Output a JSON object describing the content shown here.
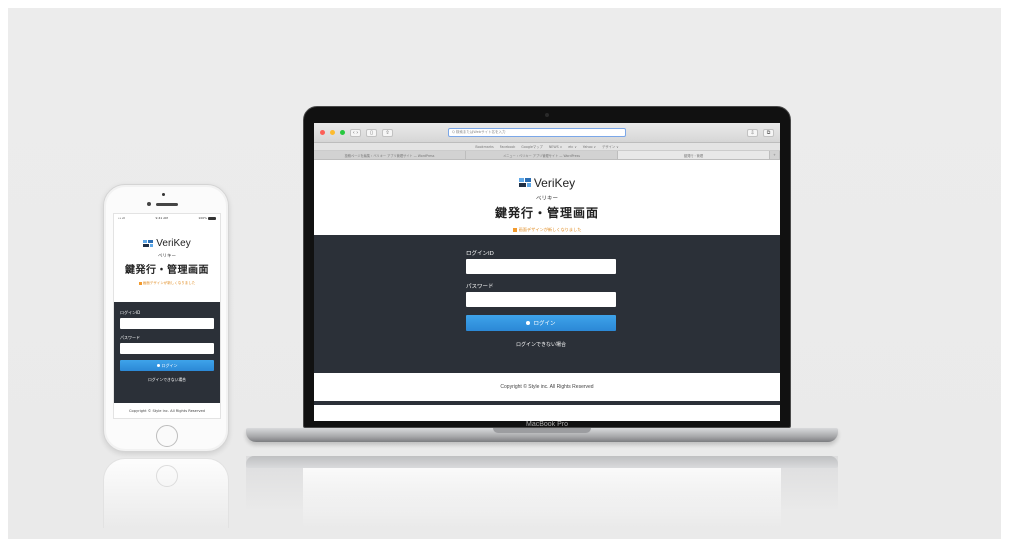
{
  "brand": {
    "name": "VeriKey",
    "kana": "ベリキー",
    "title": "鍵発行・管理画面",
    "notice": "画面デザインが新しくなりました",
    "colors": {
      "primary": "#2a6db3",
      "accent": "#5fa8e8",
      "dark_panel": "#2b3038",
      "notice": "#e08a1e",
      "button": "#2b88d6"
    }
  },
  "form": {
    "login_id_label": "ログインID",
    "password_label": "パスワード",
    "login_button": "ログイン",
    "help_link": "ログインできない場合"
  },
  "footer": {
    "copyright": "Copyright © Style inc. All Rights Reserved",
    "copyright_phone": "Copyright © Style inc. All Rights Reserved"
  },
  "phone": {
    "status_time": "9:41 AM",
    "status_carrier": "•••ll",
    "status_battery": "100%"
  },
  "browser": {
    "url_placeholder": "Q 検索またはWebサイト名を入力",
    "bookmarks": [
      "Bookmarks",
      "Facebook",
      "Googleマップ",
      "NEWS ∨",
      "etc ∨",
      "Yahoo ∨",
      "デザイン ∨"
    ],
    "tabs": [
      "投稿ページを編集 ‹ ベリキー アプリ管理サイト — WordPress",
      "メニュー ‹ ベリキー アプリ管理サイト — WordPress",
      "鍵発行・管理"
    ]
  },
  "laptop": {
    "model_label": "MacBook Pro"
  }
}
